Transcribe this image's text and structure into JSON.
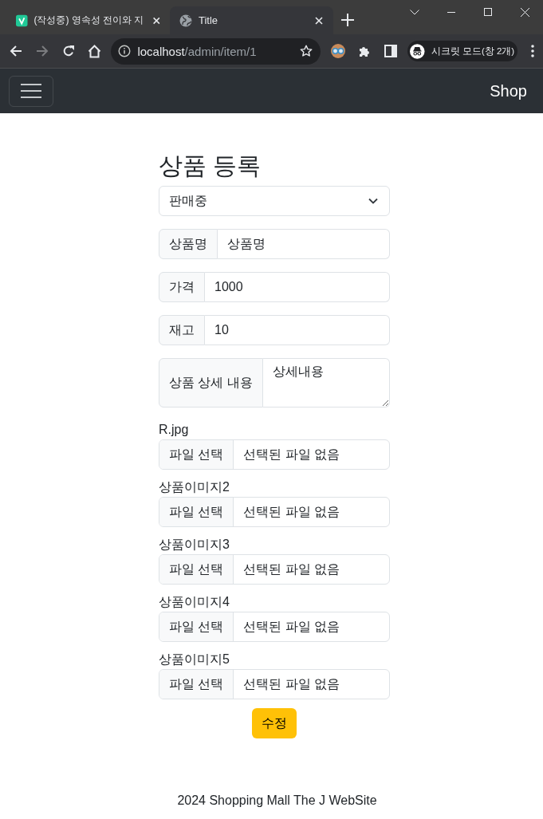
{
  "browser": {
    "tabs": [
      {
        "title": "(작성중) 영속성 전이와 지",
        "kind": "logo",
        "selected": false
      },
      {
        "title": "Title",
        "kind": "globe",
        "selected": true
      }
    ],
    "nav_buttons": [
      {
        "kind": "back",
        "disabled": false
      },
      {
        "kind": "forward",
        "disabled": true
      },
      {
        "kind": "reload",
        "disabled": false
      },
      {
        "kind": "home",
        "disabled": false
      }
    ],
    "address": {
      "host": "localhost",
      "path": "/admin/item/1"
    },
    "profile": {
      "label": "시크릿 모드(창 2개)"
    }
  },
  "navbar": {
    "brand": "Shop"
  },
  "form": {
    "title": "상품 등록",
    "status_select": {
      "value": "판매중"
    },
    "fields": [
      {
        "kind": "input",
        "label": "상품명",
        "value": "상품명"
      },
      {
        "kind": "input",
        "label": "가격",
        "value": "1000"
      },
      {
        "kind": "input",
        "label": "재고",
        "value": "10"
      },
      {
        "kind": "textarea",
        "label": "상품 상세 내용",
        "value": "상세내용"
      }
    ],
    "images": [
      {
        "label": "R.jpg",
        "button": "파일 선택",
        "status": "선택된 파일 없음"
      },
      {
        "label": "상품이미지2",
        "button": "파일 선택",
        "status": "선택된 파일 없음"
      },
      {
        "label": "상품이미지3",
        "button": "파일 선택",
        "status": "선택된 파일 없음"
      },
      {
        "label": "상품이미지4",
        "button": "파일 선택",
        "status": "선택된 파일 없음"
      },
      {
        "label": "상품이미지5",
        "button": "파일 선택",
        "status": "선택된 파일 없음"
      }
    ],
    "submit": "수정"
  },
  "footer": {
    "text": "2024 Shopping Mall The J WebSite"
  }
}
